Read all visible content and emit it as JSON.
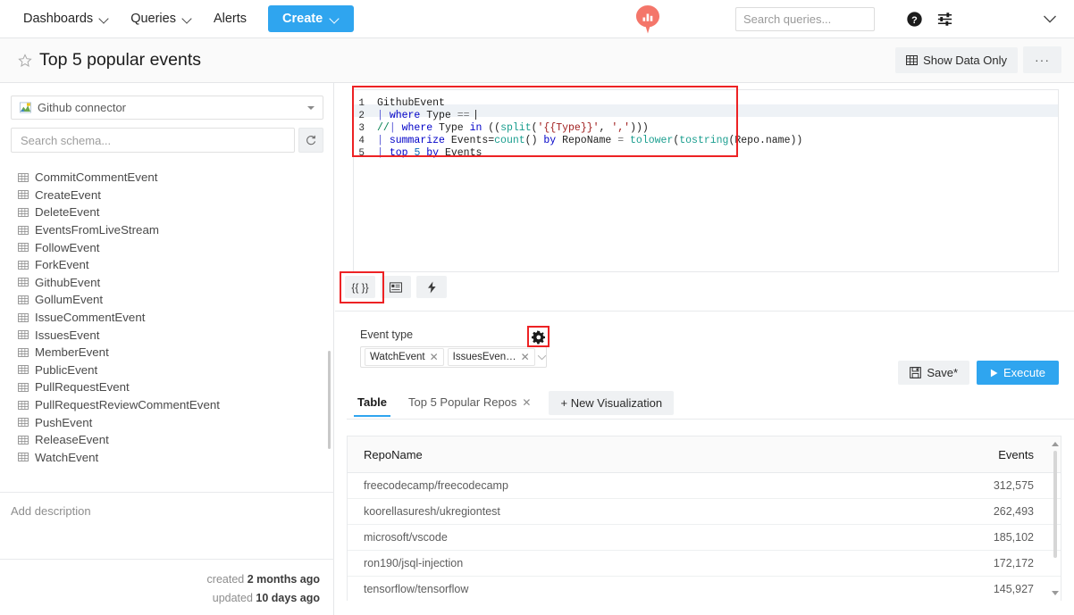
{
  "topnav": {
    "items": [
      {
        "label": "Dashboards",
        "has_caret": true
      },
      {
        "label": "Queries",
        "has_caret": true
      },
      {
        "label": "Alerts",
        "has_caret": false
      }
    ],
    "create_label": "Create",
    "logo_icon": "chart-pin-logo-icon",
    "logo_color": "#f4766a",
    "search": {
      "placeholder": "Search queries...",
      "value": "",
      "icon": "search-icon"
    },
    "help_icon": "help-circle-icon",
    "settings_icon": "settings-sliders-icon",
    "account_icon": "chevron-down-icon"
  },
  "titlebar": {
    "star_icon": "star-outline-icon",
    "title": "Top 5 popular events",
    "show_data_only_label": "Show Data Only",
    "show_data_only_icon": "grid-table-icon",
    "more_label": "···"
  },
  "sidebar": {
    "connector": {
      "label": "Github connector",
      "icon": "connector-icon"
    },
    "schema_search": {
      "placeholder": "Search schema...",
      "value": ""
    },
    "refresh_icon": "refresh-icon",
    "schema_items": [
      "CommitCommentEvent",
      "CreateEvent",
      "DeleteEvent",
      "EventsFromLiveStream",
      "FollowEvent",
      "ForkEvent",
      "GithubEvent",
      "GollumEvent",
      "IssueCommentEvent",
      "IssuesEvent",
      "MemberEvent",
      "PublicEvent",
      "PullRequestEvent",
      "PullRequestReviewCommentEvent",
      "PushEvent",
      "ReleaseEvent",
      "WatchEvent"
    ],
    "description_placeholder": "Add description",
    "created_prefix": "created",
    "created_value": "2 months ago",
    "updated_prefix": "updated",
    "updated_value": "10 days ago"
  },
  "editor": {
    "lines": [
      {
        "num": "1",
        "text": "GithubEvent"
      },
      {
        "num": "2",
        "text": "| where Type == "
      },
      {
        "num": "3",
        "text": "//| where Type in ((split('{{Type}}', ',')))"
      },
      {
        "num": "4",
        "text": "| summarize Events=count() by RepoName = tolower(tostring(Repo.name))"
      },
      {
        "num": "5",
        "text": "| top 5 by Events"
      }
    ],
    "active_line": 2,
    "highlight_color": "#ed2224"
  },
  "editor_toolbar": {
    "buttons": [
      {
        "label": "{{ }}",
        "name": "parameters-button",
        "highlighted": true
      },
      {
        "label": "",
        "name": "card-view-button",
        "highlighted": false
      },
      {
        "label": "",
        "name": "lightning-button",
        "highlighted": false
      }
    ],
    "save_label": "Save*",
    "save_icon": "floppy-disk-icon",
    "execute_label": "Execute",
    "execute_icon": "play-icon"
  },
  "parameters": {
    "label": "Event type",
    "gear_icon": "gear-icon",
    "gear_highlighted": true,
    "chips": [
      "WatchEvent",
      "IssuesEven…"
    ],
    "chip_remove_icon": "close-x-icon",
    "dropdown_icon": "chevron-down-icon"
  },
  "visualizations": {
    "tabs": [
      {
        "label": "Table",
        "active": true,
        "closable": false
      },
      {
        "label": "Top 5 Popular Repos",
        "active": false,
        "closable": true
      }
    ],
    "new_viz_label": "+ New Visualization"
  },
  "results": {
    "columns": [
      "RepoName",
      "Events"
    ],
    "rows": [
      {
        "repo": "freecodecamp/freecodecamp",
        "events": "312,575"
      },
      {
        "repo": "koorellasuresh/ukregiontest",
        "events": "262,493"
      },
      {
        "repo": "microsoft/vscode",
        "events": "185,102"
      },
      {
        "repo": "ron190/jsql-injection",
        "events": "172,172"
      },
      {
        "repo": "tensorflow/tensorflow",
        "events": "145,927"
      }
    ]
  },
  "colors": {
    "accent_blue": "#2fa5ef",
    "logo_salmon": "#f4766a",
    "annotation_red": "#ed2224",
    "panel_grey": "#eff1f3"
  }
}
